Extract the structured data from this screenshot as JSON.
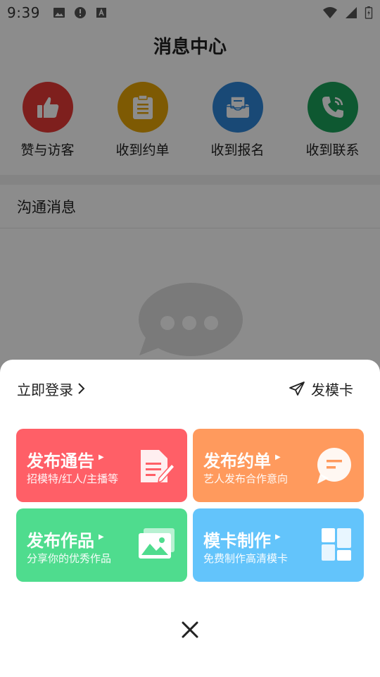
{
  "statusbar": {
    "time": "9:39"
  },
  "header": {
    "title": "消息中心"
  },
  "quick_actions": [
    {
      "label": "赞与访客",
      "color": "#e53935",
      "icon": "thumbs-up-icon"
    },
    {
      "label": "收到约单",
      "color": "#e5a406",
      "icon": "clipboard-icon"
    },
    {
      "label": "收到报名",
      "color": "#2f86d8",
      "icon": "inbox-icon"
    },
    {
      "label": "收到联系",
      "color": "#1aa05a",
      "icon": "phone-icon"
    }
  ],
  "section": {
    "title": "沟通消息"
  },
  "sheet": {
    "login": "立即登录",
    "publish_modcard": "发模卡",
    "cards": [
      {
        "title": "发布通告",
        "subtitle": "招模特/红人/主播等",
        "color": "#ff5f67",
        "icon": "document-edit-icon"
      },
      {
        "title": "发布约单",
        "subtitle": "艺人发布合作意向",
        "color": "#ff9a5d",
        "icon": "chat-bubble-icon"
      },
      {
        "title": "发布作品",
        "subtitle": "分享你的优秀作品",
        "color": "#4fdc8e",
        "icon": "image-icon"
      },
      {
        "title": "模卡制作",
        "subtitle": "免费制作高清模卡",
        "color": "#63c4fb",
        "icon": "grid-layout-icon"
      }
    ]
  }
}
